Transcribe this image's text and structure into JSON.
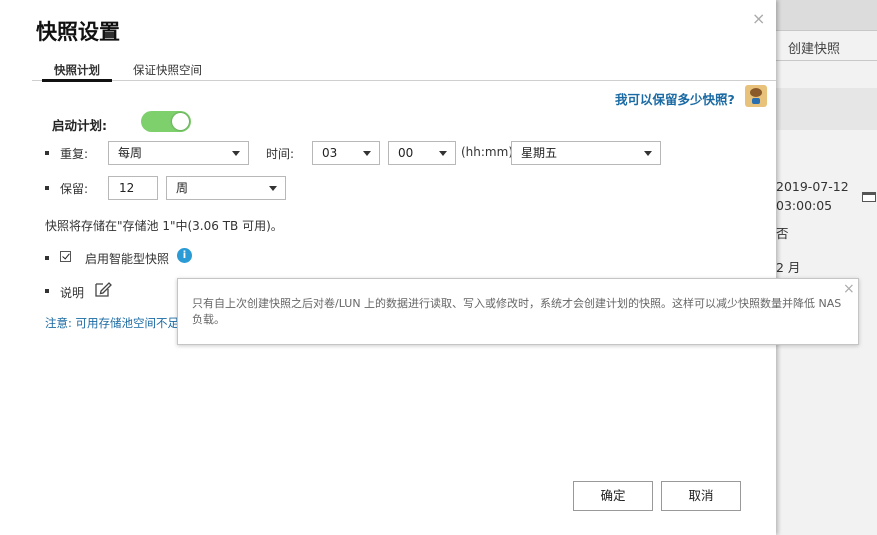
{
  "background_app": {
    "create_snapshot": "创建快照",
    "date": "2019-07-12",
    "time": "03:00:05",
    "frag1": "否",
    "frag2": "2 月"
  },
  "dialog": {
    "title": "快照设置",
    "close": "×",
    "tabs": [
      "快照计划",
      "保证快照空间"
    ],
    "help_link": "我可以保留多少快照?",
    "schedule_label": "启动计划:",
    "schedule_enabled": true,
    "repeat_label": "重复:",
    "repeat_value": "每周",
    "time_label": "时间:",
    "hour_value": "03",
    "minute_value": "00",
    "time_format": "(hh:mm)",
    "weekday_value": "星期五",
    "retain_label": "保留:",
    "retain_count": "12",
    "retain_unit": "周",
    "storage_info": "快照将存储在\"存储池 1\"中(3.06 TB 可用)。",
    "smart_snapshot_label": "启用智能型快照",
    "smart_snapshot_checked": true,
    "info_glyph": "i",
    "description_label": "说明",
    "note_text": "注意: 可用存储池空间不足",
    "ok_button": "确定",
    "cancel_button": "取消"
  },
  "tooltip": {
    "text": "只有自上次创建快照之后对卷/LUN 上的数据进行读取、写入或修改时，系统才会创建计划的快照。这样可以减少快照数量并降低 NAS 负载。",
    "close": "×"
  },
  "colors": {
    "toggle_on": "#7dd06c",
    "link": "#1a6aa3",
    "info": "#2b9bd6"
  }
}
